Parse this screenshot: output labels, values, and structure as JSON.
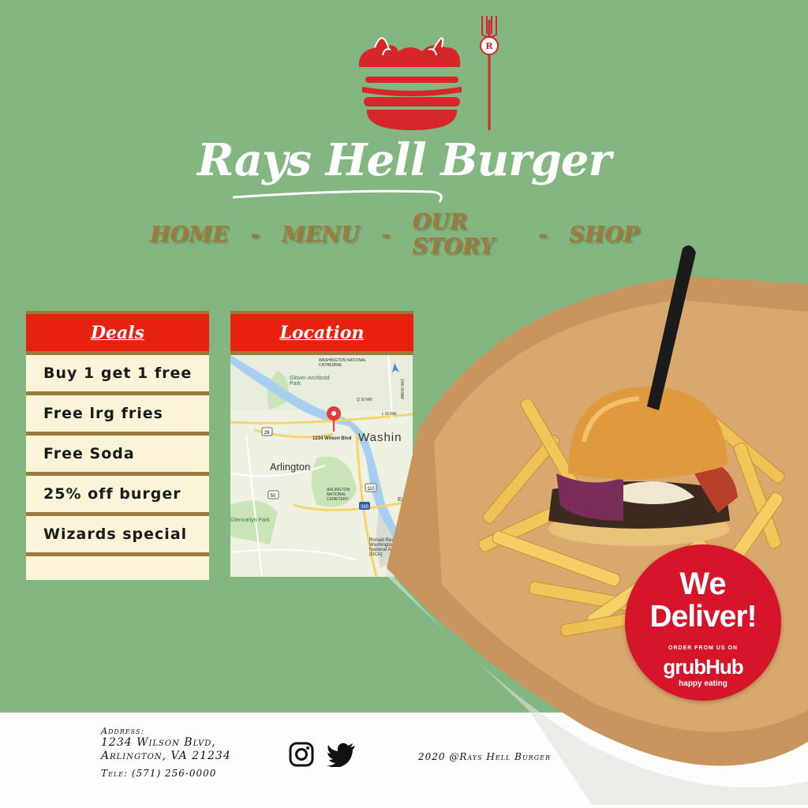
{
  "brand": {
    "name": "Rays Hell Burger",
    "mark": "R"
  },
  "nav": {
    "home": "HOME",
    "menu": "MENU",
    "story": "OUR STORY",
    "shop": "SHOP",
    "separator": "-"
  },
  "deals": {
    "title": "Deals",
    "items": [
      "Buy 1 get 1 free",
      "Free lrg fries",
      "Free Soda",
      "25% off burger",
      "Wizards special"
    ]
  },
  "location": {
    "title": "Location",
    "map": {
      "pin_label": "1234 Wilson Blvd",
      "places": [
        "Glover-Archbold Park",
        "WASHINGTON NATIONAL CATHEDRAL",
        "Washin",
        "Arlington",
        "ARLINGTON NATIONAL CEMETERY",
        "Glencarlyn Park",
        "Ronald Reagan Washington National Airport (DCA)",
        "Q St NW",
        "L St NW",
        "14th St NW",
        "East"
      ],
      "road_shields": [
        "29",
        "50",
        "110",
        "395"
      ]
    }
  },
  "badge": {
    "line1": "We",
    "line2": "Deliver!",
    "order": "ORDER FROM US ON",
    "service": "grubHub",
    "tagline": "happy eating"
  },
  "footer": {
    "address_label": "Address:",
    "address_line1": "1234 Wilson Blvd,",
    "address_line2": "Arlington, VA 21234",
    "tel": "Tele: (571) 256-0000",
    "copyright": "2020 @Rays Hell Burger"
  },
  "colors": {
    "background": "#83b680",
    "accent_red": "#e8200e",
    "panel_cream": "#fbf4d8",
    "panel_brown": "#9b7a3b",
    "nav_brown": "#9f7a3c"
  },
  "icons": [
    "burger-logo-icon",
    "fork-icon",
    "instagram-icon",
    "twitter-icon",
    "map-pin-icon"
  ]
}
